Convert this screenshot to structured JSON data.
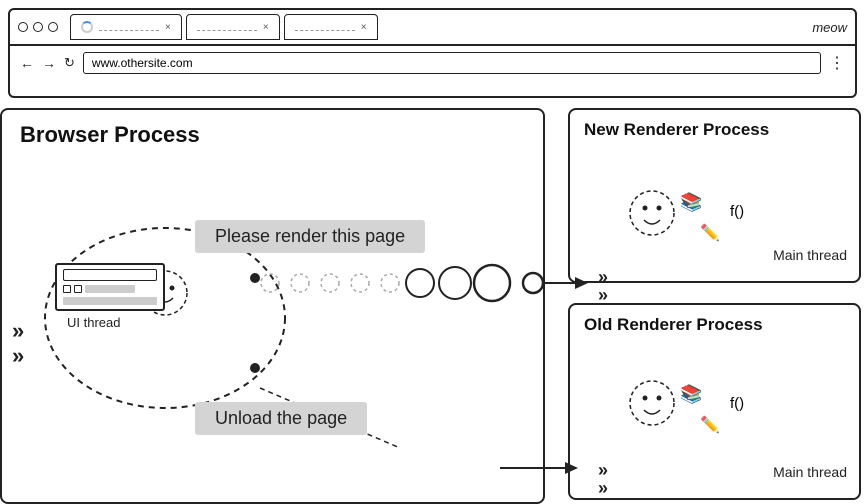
{
  "browser": {
    "tabs": [
      {
        "label": "",
        "active": true,
        "has_spinner": true
      },
      {
        "label": "",
        "active": false,
        "has_spinner": false
      },
      {
        "label": "",
        "active": false,
        "has_spinner": false
      }
    ],
    "meow": "meow",
    "address": "www.othersite.com"
  },
  "diagram": {
    "browser_process_label": "Browser Process",
    "new_renderer_label": "New Renderer Process",
    "old_renderer_label": "Old Renderer Process",
    "ui_thread_label": "UI thread",
    "main_thread_label": "Main thread",
    "please_render_msg": "Please render this page",
    "unload_msg": "Unload the page"
  }
}
